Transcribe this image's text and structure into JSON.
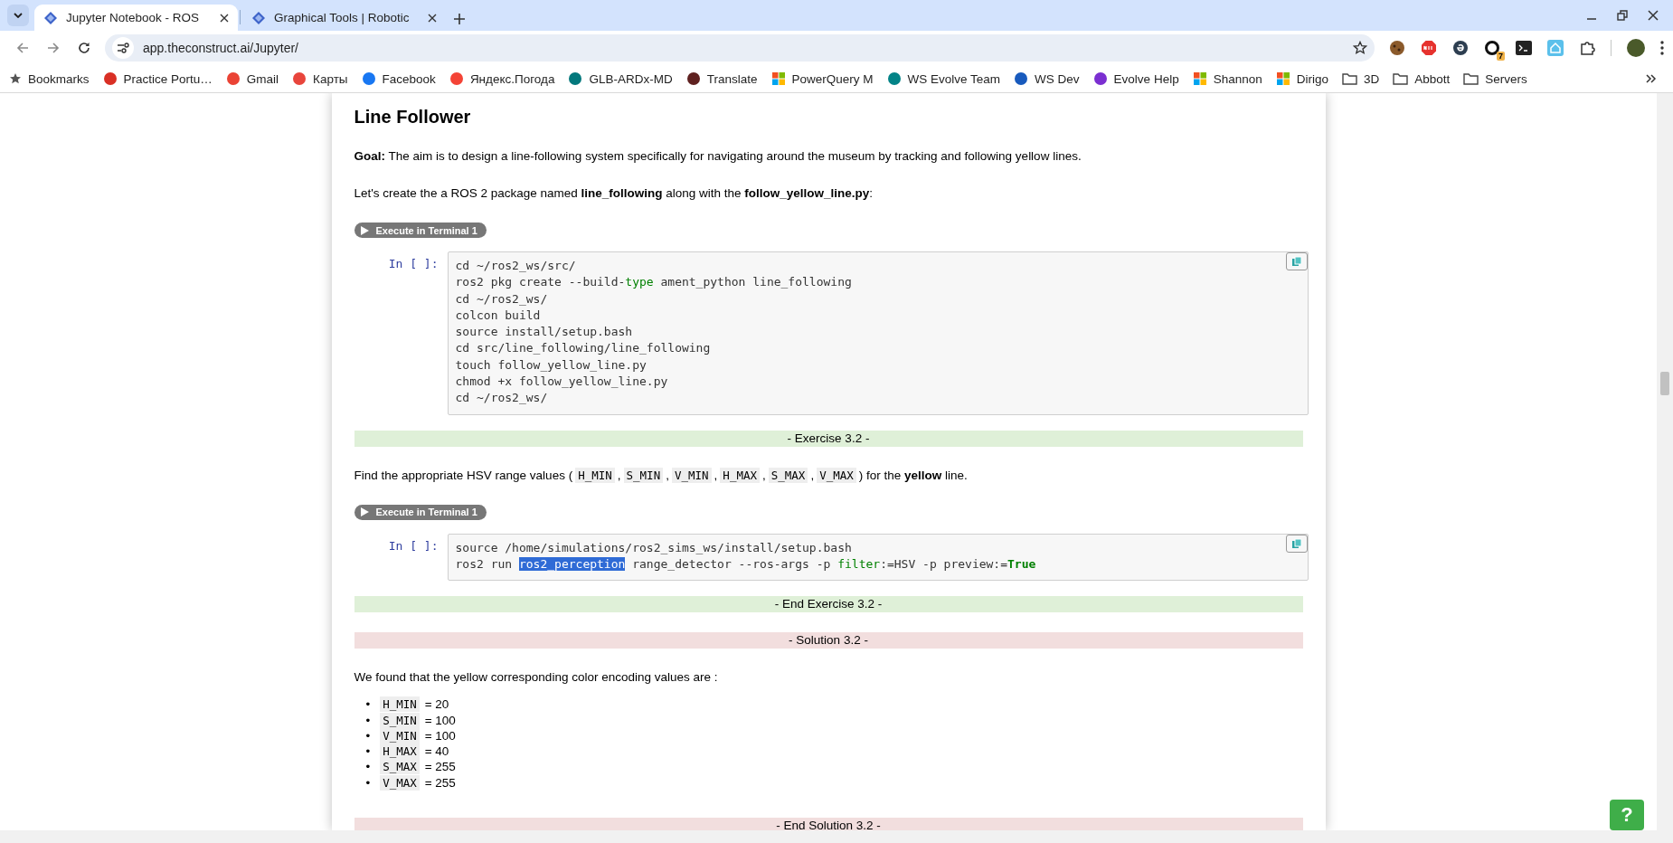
{
  "browser": {
    "tabs": [
      {
        "title": "Jupyter Notebook - ROS",
        "selected": true
      },
      {
        "title": "Graphical Tools | Robotic",
        "selected": false
      }
    ],
    "address": "app.theconstruct.ai/Jupyter/",
    "extension_badge": "7",
    "bookmarks": [
      {
        "label": "Bookmarks",
        "kind": "star"
      },
      {
        "label": "Practice Portu…",
        "kind": "site",
        "color": "#d93025"
      },
      {
        "label": "Gmail",
        "kind": "site",
        "color": "#ea4335"
      },
      {
        "label": "Карты",
        "kind": "site",
        "color": "#e8453c"
      },
      {
        "label": "Facebook",
        "kind": "site",
        "color": "#1877f2"
      },
      {
        "label": "Яндекс.Погода",
        "kind": "site",
        "color": "#f44336"
      },
      {
        "label": "GLB-ARDx-MD",
        "kind": "site",
        "color": "#03787c"
      },
      {
        "label": "Translate",
        "kind": "site",
        "color": "#5f2120"
      },
      {
        "label": "PowerQuery M",
        "kind": "windows"
      },
      {
        "label": "WS Evolve Team",
        "kind": "site",
        "color": "#038387"
      },
      {
        "label": "WS Dev",
        "kind": "site",
        "color": "#185abd"
      },
      {
        "label": "Evolve Help",
        "kind": "site",
        "color": "#7b2fd1"
      },
      {
        "label": "Shannon",
        "kind": "windows"
      },
      {
        "label": "Dirigo",
        "kind": "windows"
      },
      {
        "label": "3D",
        "kind": "folder"
      },
      {
        "label": "Abbott",
        "kind": "folder"
      },
      {
        "label": "Servers",
        "kind": "folder"
      }
    ]
  },
  "notebook": {
    "cells": [
      {
        "kind": "heading",
        "text": "Line Follower"
      },
      {
        "kind": "paragraph",
        "parts": [
          {
            "kind": "text",
            "text": "**Goal:** The aim is to design a line-following system specifically for navigating around the museum by tracking and following yellow lines."
          }
        ]
      },
      {
        "kind": "paragraph",
        "parts": [
          {
            "kind": "text",
            "text": "Let's create the a ROS 2 package named **line_following** along with the **follow_yellow_line.py**:"
          }
        ]
      },
      {
        "kind": "run",
        "label": "Execute in Terminal 1"
      },
      {
        "kind": "code",
        "prompt": "In [ ]:",
        "lines": [
          [
            {
              "kind": "plain",
              "text": "cd ~/ros2_ws/src/"
            }
          ],
          [
            {
              "kind": "plain",
              "text": "ros2 pkg create --build-"
            },
            {
              "kind": "keyword",
              "text": "type"
            },
            {
              "kind": "plain",
              "text": " ament_python line_following"
            }
          ],
          [
            {
              "kind": "plain",
              "text": "cd ~/ros2_ws/"
            }
          ],
          [
            {
              "kind": "plain",
              "text": "colcon build"
            }
          ],
          [
            {
              "kind": "plain",
              "text": "source install/setup.bash"
            }
          ],
          [
            {
              "kind": "plain",
              "text": "cd src/line_following/line_following"
            }
          ],
          [
            {
              "kind": "plain",
              "text": "touch follow_yellow_line.py"
            }
          ],
          [
            {
              "kind": "plain",
              "text": "chmod +x follow_yellow_line.py"
            }
          ],
          [
            {
              "kind": "plain",
              "text": "cd ~/ros2_ws/"
            }
          ]
        ]
      },
      {
        "kind": "banner",
        "color": "#dff0d8",
        "text": "- Exercise 3.2 -"
      },
      {
        "kind": "paragraph",
        "parts": [
          {
            "kind": "text",
            "text": "Find the appropriate HSV range values ("
          },
          {
            "kind": "code",
            "text": "H_MIN"
          },
          {
            "kind": "text",
            "text": ","
          },
          {
            "kind": "code",
            "text": "S_MIN"
          },
          {
            "kind": "text",
            "text": ","
          },
          {
            "kind": "code",
            "text": "V_MIN"
          },
          {
            "kind": "text",
            "text": ","
          },
          {
            "kind": "code",
            "text": "H_MAX"
          },
          {
            "kind": "text",
            "text": ","
          },
          {
            "kind": "code",
            "text": "S_MAX"
          },
          {
            "kind": "text",
            "text": ","
          },
          {
            "kind": "code",
            "text": "V_MAX"
          },
          {
            "kind": "text",
            "text": ") for the **yellow** line."
          }
        ]
      },
      {
        "kind": "run",
        "label": "Execute in Terminal 1"
      },
      {
        "kind": "code",
        "prompt": "In [ ]:",
        "lines": [
          [
            {
              "kind": "plain",
              "text": "source /home/simulations/ros2_sims_ws/install/setup.bash"
            }
          ],
          [
            {
              "kind": "plain",
              "text": "ros2 run "
            },
            {
              "kind": "selected",
              "text": "ros2_perception"
            },
            {
              "kind": "plain",
              "text": " range_detector --ros-args -p "
            },
            {
              "kind": "keyword",
              "text": "filter"
            },
            {
              "kind": "plain",
              "text": ":=HSV -p preview:="
            },
            {
              "kind": "constant",
              "text": "True"
            }
          ]
        ]
      },
      {
        "kind": "banner",
        "color": "#dff0d8",
        "text": "- End Exercise 3.2 -"
      },
      {
        "kind": "banner",
        "color": "#f2dede",
        "text": "- Solution 3.2 -"
      },
      {
        "kind": "paragraph",
        "parts": [
          {
            "kind": "text",
            "text": "We found that the yellow corresponding color encoding values are :"
          }
        ]
      },
      {
        "kind": "list",
        "bullet": "•",
        "items": [
          {
            "code": "H_MIN",
            "text": " = 20"
          },
          {
            "code": "S_MIN",
            "text": " = 100"
          },
          {
            "code": "V_MIN",
            "text": " = 100"
          },
          {
            "code": "H_MAX",
            "text": " = 40"
          },
          {
            "code": "S_MAX",
            "text": " = 255"
          },
          {
            "code": "V_MAX",
            "text": " = 255"
          }
        ]
      },
      {
        "kind": "banner",
        "color": "#f2dede",
        "text": "- End Solution 3.2 -"
      }
    ]
  },
  "help_button": "?"
}
